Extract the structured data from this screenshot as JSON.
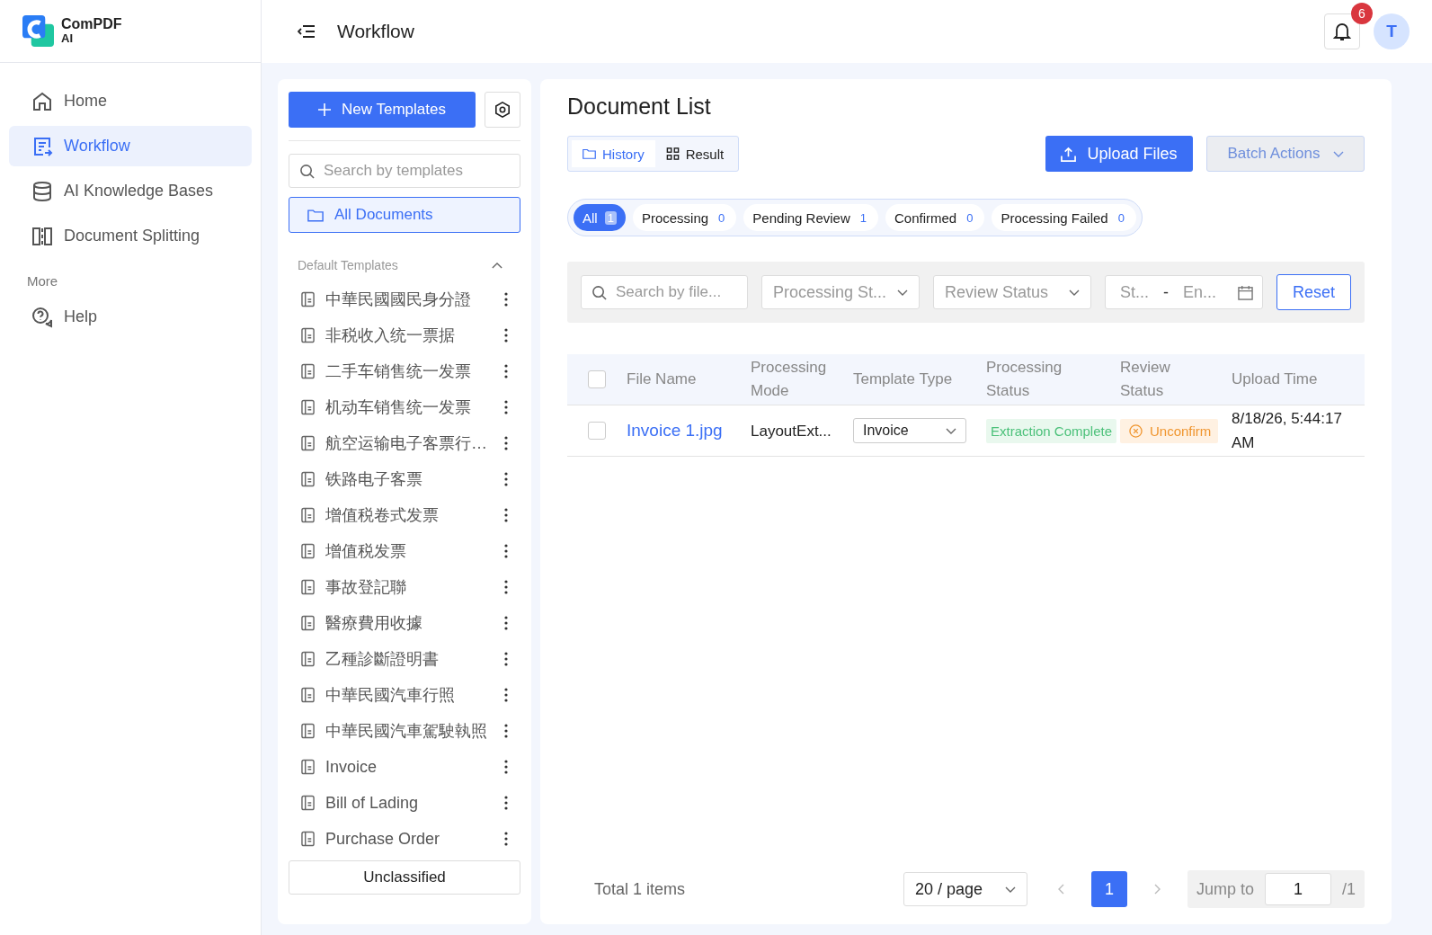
{
  "logo": {
    "name": "ComPDF",
    "sub": "AI"
  },
  "header": {
    "title": "Workflow",
    "notifications": "6",
    "avatar": "T"
  },
  "sidebar": {
    "items": [
      {
        "label": "Home",
        "kind": "home",
        "selected": false
      },
      {
        "label": "Workflow",
        "kind": "workflow",
        "selected": true
      },
      {
        "label": "AI Knowledge Bases",
        "kind": "database",
        "selected": false
      },
      {
        "label": "Document Splitting",
        "kind": "split",
        "selected": false
      }
    ],
    "more_heading": "More",
    "more_items": [
      {
        "label": "Help",
        "kind": "help",
        "selected": false
      }
    ]
  },
  "templates_panel": {
    "new_button": "New Templates",
    "search": {
      "placeholder": "Search by templates"
    },
    "all_documents": {
      "label": "All Documents",
      "selected": true
    },
    "section": {
      "title": "Default Templates",
      "expanded": true
    },
    "items": [
      "中華民國國民身分證",
      "非税收入统一票据",
      "二手车销售统一发票",
      "机动车销售统一发票",
      "航空运输电子客票行…",
      "铁路电子客票",
      "增值税卷式发票",
      "增值税发票",
      "事故登記聯",
      "醫療費用收據",
      "乙種診斷證明書",
      "中華民國汽車行照",
      "中華民國汽車駕駛執照",
      "Invoice",
      "Bill of Lading",
      "Purchase Order"
    ],
    "unclassified": "Unclassified"
  },
  "document_list": {
    "title": "Document List",
    "view_tabs": [
      {
        "label": "History",
        "kind": "folder",
        "selected": true
      },
      {
        "label": "Result",
        "kind": "grid",
        "selected": false
      }
    ],
    "upload_button": "Upload Files",
    "batch_button": {
      "label": "Batch Actions",
      "disabled": true
    },
    "status_filters": [
      {
        "label": "All",
        "count": "1",
        "selected": true
      },
      {
        "label": "Processing",
        "count": "0",
        "selected": false
      },
      {
        "label": "Pending Review",
        "count": "1",
        "selected": false
      },
      {
        "label": "Confirmed",
        "count": "0",
        "selected": false
      },
      {
        "label": "Processing Failed",
        "count": "0",
        "selected": false
      }
    ],
    "filters": {
      "search": {
        "placeholder": "Search by file..."
      },
      "processing_status": {
        "placeholder": "Processing St..."
      },
      "review_status": {
        "placeholder": "Review Status"
      },
      "date_range": {
        "start_placeholder": "St...",
        "separator": "-",
        "end_placeholder": "En..."
      },
      "reset": "Reset"
    },
    "table": {
      "all_checked": false,
      "columns": [
        "File Name",
        "Processing Mode",
        "Template Type",
        "Processing Status",
        "Review Status",
        "Upload Time"
      ],
      "rows": [
        {
          "checked": false,
          "file_name": "Invoice 1.jpg",
          "processing_mode": "LayoutExt...",
          "template_type": "Invoice",
          "processing_status": "Extraction Complete",
          "review_status": "Unconfirm",
          "upload_time": "8/18/26, 5:44:17 AM"
        }
      ]
    },
    "pagination": {
      "total": "Total 1 items",
      "page_size": "20 / page",
      "pages": [
        {
          "label": "1",
          "selected": true
        }
      ],
      "jump_label": "Jump to",
      "jump_value": "1",
      "page_count": "/1"
    }
  }
}
